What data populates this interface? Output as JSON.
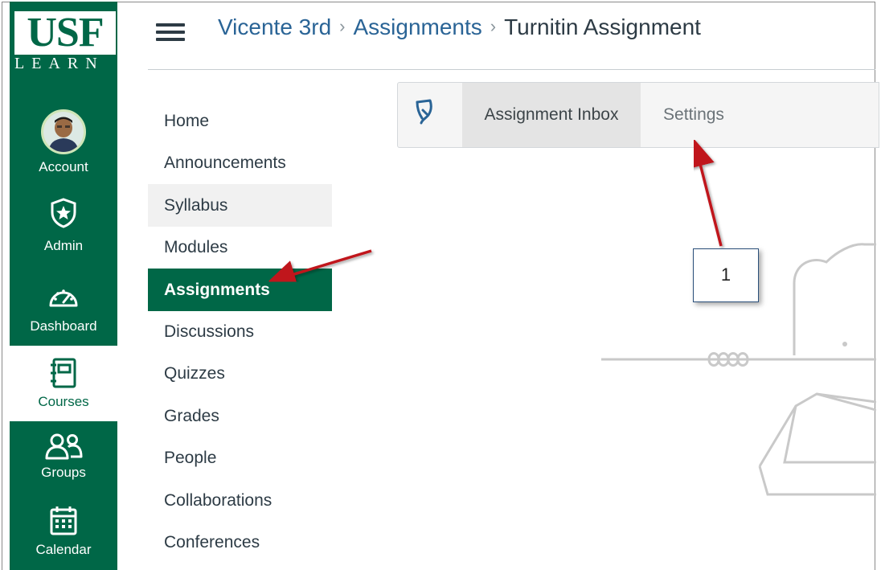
{
  "logo": {
    "primary": "USF",
    "secondary": "LEARN"
  },
  "global_nav": {
    "items": [
      {
        "label": "Account",
        "icon": "avatar"
      },
      {
        "label": "Admin",
        "icon": "shield-star-icon"
      },
      {
        "label": "Dashboard",
        "icon": "speedometer-icon"
      },
      {
        "label": "Courses",
        "icon": "notebook-icon",
        "active": true
      },
      {
        "label": "Groups",
        "icon": "people-icon"
      },
      {
        "label": "Calendar",
        "icon": "calendar-icon"
      }
    ]
  },
  "breadcrumb": {
    "course": "Vicente 3rd",
    "section": "Assignments",
    "current": "Turnitin Assignment",
    "separator": "›"
  },
  "course_nav": {
    "items": [
      {
        "label": "Home"
      },
      {
        "label": "Announcements"
      },
      {
        "label": "Syllabus",
        "state": "hover"
      },
      {
        "label": "Modules"
      },
      {
        "label": "Assignments",
        "state": "active"
      },
      {
        "label": "Discussions"
      },
      {
        "label": "Quizzes"
      },
      {
        "label": "Grades"
      },
      {
        "label": "People"
      },
      {
        "label": "Collaborations"
      },
      {
        "label": "Conferences"
      }
    ]
  },
  "toolbar": {
    "icon": "turnitin-icon",
    "tabs": [
      {
        "label": "Assignment Inbox",
        "selected": true
      },
      {
        "label": "Settings",
        "selected": false
      }
    ]
  },
  "annotation": {
    "callout_label": "1"
  },
  "colors": {
    "brand_green": "#006747",
    "link_blue": "#2a6496",
    "text_dark": "#2d3b45",
    "arrow_red": "#c0161b"
  }
}
